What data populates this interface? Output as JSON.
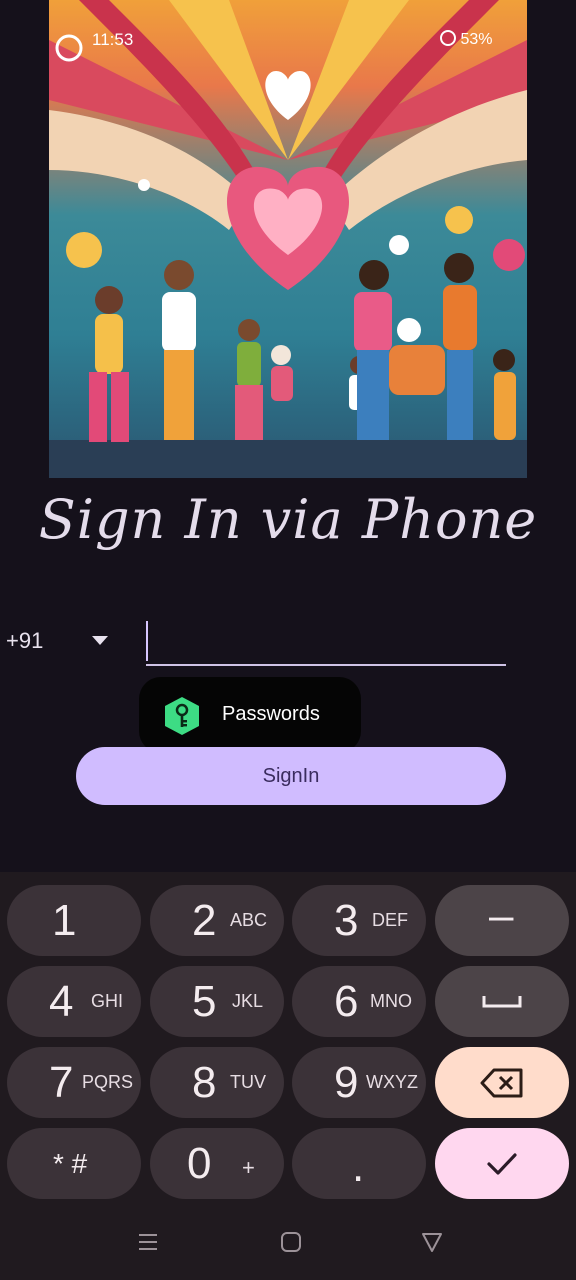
{
  "status_bar": {
    "time": "11:53",
    "battery": "53%"
  },
  "title": "Sign In via Phone",
  "phone": {
    "country_code": "+91",
    "value": "",
    "placeholder": ""
  },
  "autofill": {
    "label": "Passwords"
  },
  "signin_label": "SignIn",
  "keyboard": {
    "rows": [
      [
        {
          "num": "1",
          "letters": ""
        },
        {
          "num": "2",
          "letters": "ABC"
        },
        {
          "num": "3",
          "letters": "DEF"
        },
        {
          "fn": "–"
        }
      ],
      [
        {
          "num": "4",
          "letters": "GHI"
        },
        {
          "num": "5",
          "letters": "JKL"
        },
        {
          "num": "6",
          "letters": "MNO"
        },
        {
          "fn": "space"
        }
      ],
      [
        {
          "num": "7",
          "letters": "PQRS"
        },
        {
          "num": "8",
          "letters": "TUV"
        },
        {
          "num": "9",
          "letters": "WXYZ"
        },
        {
          "fn": "backspace"
        }
      ],
      [
        {
          "num": "* #",
          "letters": ""
        },
        {
          "num": "0",
          "letters": "+"
        },
        {
          "num": ".",
          "letters": ""
        },
        {
          "fn": "done"
        }
      ]
    ],
    "k1": "1",
    "k2": "2",
    "k2l": "ABC",
    "k3": "3",
    "k3l": "DEF",
    "kdash": "–",
    "k4": "4",
    "k4l": "GHI",
    "k5": "5",
    "k5l": "JKL",
    "k6": "6",
    "k6l": "MNO",
    "k7": "7",
    "k7l": "PQRS",
    "k8": "8",
    "k8l": "TUV",
    "k9": "9",
    "k9l": "WXYZ",
    "kstar": "* #",
    "k0": "0",
    "k0l": "+",
    "kdot": ".",
    "colors": {
      "key": "#3b3238",
      "fn": "#4c4448",
      "backspace": "#ffdccb",
      "done": "#ffd7ef"
    }
  },
  "colors": {
    "background": "#15111b",
    "accent": "#d0bcff",
    "title": "#e4dceb"
  },
  "icons": [
    "key-icon",
    "backspace-icon",
    "check-icon",
    "space-icon",
    "dropdown-arrow-icon",
    "nav-recents-icon",
    "nav-home-icon",
    "nav-back-icon"
  ]
}
